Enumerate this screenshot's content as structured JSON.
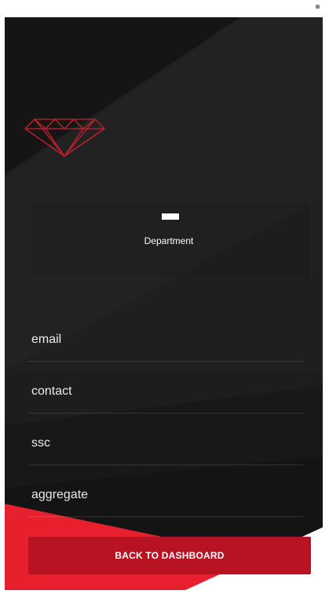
{
  "profile": {
    "department_label": "Department"
  },
  "fields": {
    "email": "email",
    "contact": "contact",
    "ssc": "ssc",
    "aggregate": "aggregate"
  },
  "actions": {
    "back_label": "BACK TO DASHBOARD"
  },
  "colors": {
    "background": "#1d1d1d",
    "accent_red": "#e8202d",
    "button_red": "#b81322",
    "logo_red": "#c8202c"
  },
  "icons": {
    "logo": "diamond-icon"
  }
}
